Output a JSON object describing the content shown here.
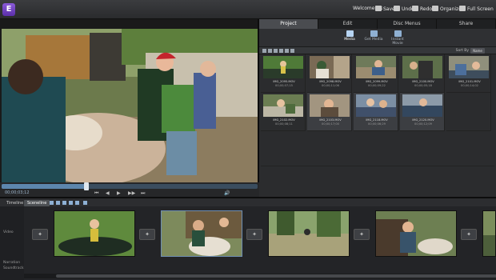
{
  "app": {
    "icon_letter": "E"
  },
  "topbar": {
    "welcome": "Welcome, JR",
    "save": "Save",
    "undo": "Undo",
    "redo": "Redo",
    "organizer": "Organizer",
    "full_screen": "Full Screen"
  },
  "preview": {
    "timecode": "00;00;03;12",
    "transport": [
      "⏮",
      "◀",
      "▶",
      "▶▶",
      "⏭",
      "🔊"
    ]
  },
  "panel": {
    "tabs": [
      "Project",
      "Edit",
      "Disc Menus",
      "Share"
    ],
    "active_tab": "Project",
    "subtabs": [
      "Media",
      "Get Media",
      "Instant Movie"
    ],
    "active_subtab": "Media",
    "sort_label": "Sort By",
    "sort_value": "Name",
    "clips": [
      {
        "name": "IMG_2095.MOV",
        "dur": "00;00;07;15"
      },
      {
        "name": "IMG_2098.MOV",
        "dur": "00;00;11;06"
      },
      {
        "name": "IMG_2099.MOV",
        "dur": "00;00;09;22"
      },
      {
        "name": "IMG_2100.MOV",
        "dur": "00;00;05;18"
      },
      {
        "name": "IMG_2101.MOV",
        "dur": "00;00;14;02"
      },
      {
        "name": "IMG_2102.MOV",
        "dur": "00;00;08;11"
      },
      {
        "name": "IMG_2103.MOV",
        "dur": "00;00;17;00"
      },
      {
        "name": "IMG_2118.MOV",
        "dur": "00;00;06;29"
      },
      {
        "name": "IMG_2120.MOV",
        "dur": "00;00;12;09"
      }
    ]
  },
  "timeline": {
    "timeline_btn": "Timeline",
    "sceneline_btn": "Sceneline",
    "tracks": [
      "Video",
      "Narration",
      "Soundtrack"
    ]
  },
  "colors": {
    "accent": "#6f8fb3",
    "panel": "#2b2c2e"
  }
}
